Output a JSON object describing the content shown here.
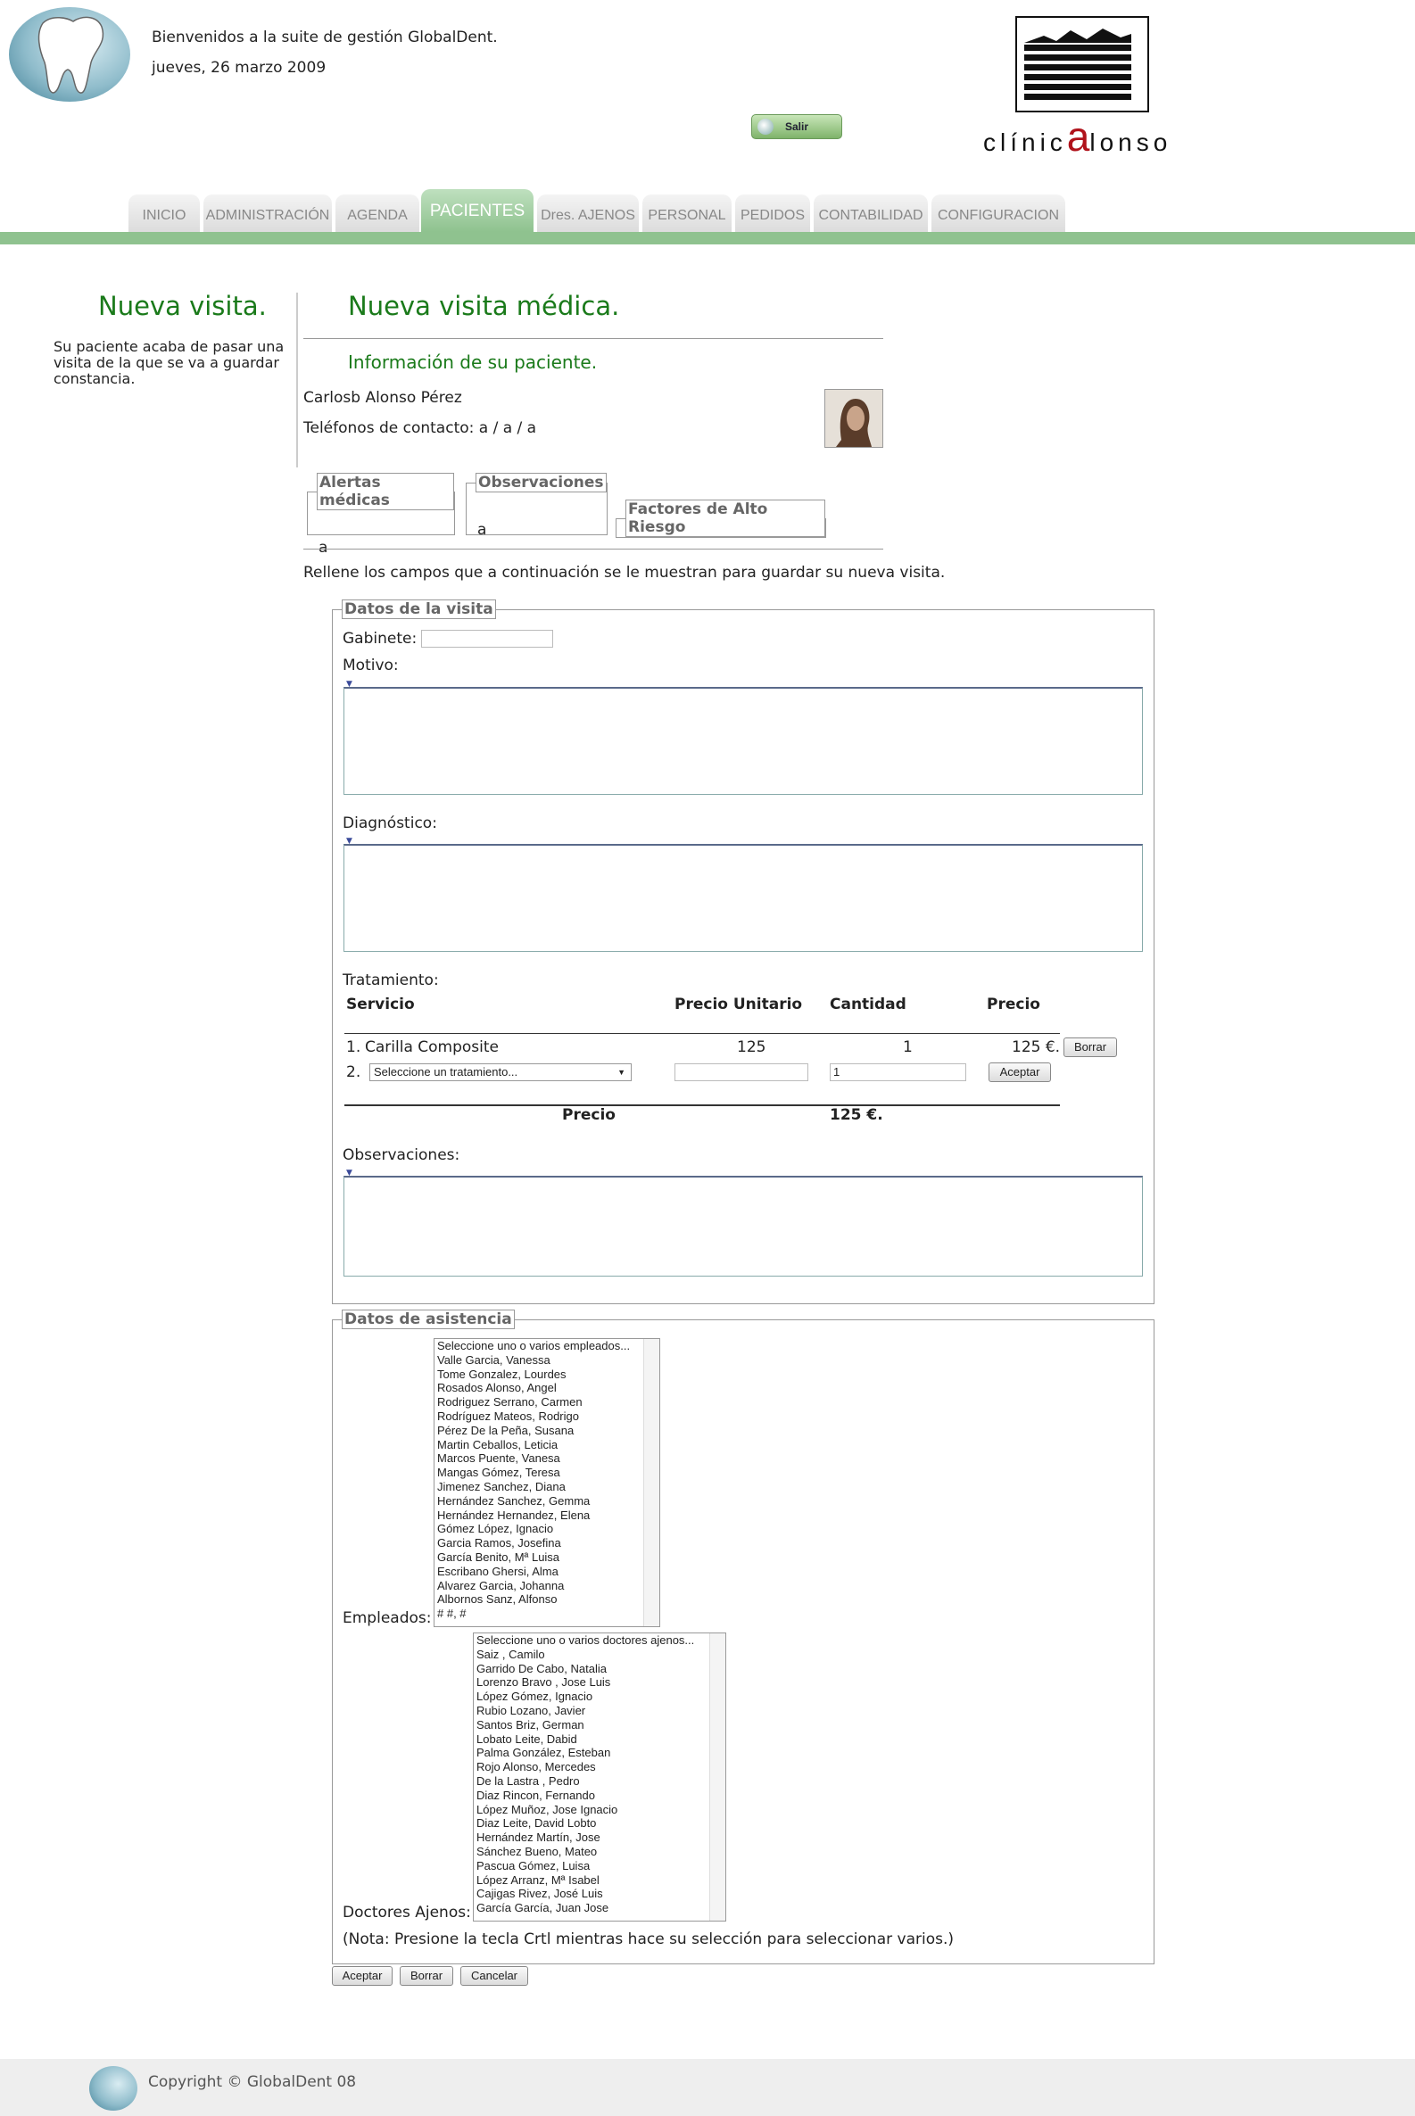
{
  "header": {
    "welcome": "Bienvenidos a la suite de gestión GlobalDent.",
    "date": "jueves, 26 marzo 2009",
    "exit_label": "Salir",
    "brand_prefix": "clínic",
    "brand_letter": "a",
    "brand_suffix": "lonso"
  },
  "nav": {
    "tabs": [
      "INICIO",
      "ADMINISTRACIÓN",
      "AGENDA",
      "PACIENTES",
      "Dres. AJENOS",
      "PERSONAL",
      "PEDIDOS",
      "CONTABILIDAD",
      "CONFIGURACION"
    ],
    "active": "PACIENTES"
  },
  "sidebar": {
    "title": "Nueva visita.",
    "text": "Su paciente acaba de pasar una visita de la que se va a guardar constancia."
  },
  "main": {
    "title": "Nueva visita médica.",
    "info_title": "Información de su paciente.",
    "patient_name": "Carlosb Alonso Pérez",
    "phones": "Teléfonos de contacto: a / a / a",
    "alerts_legend": "Alertas médicas",
    "alerts_value": "a",
    "obs_legend": "Observaciones",
    "obs_value": "a",
    "risk_legend": "Factores de Alto Riesgo",
    "fill_text": "Rellene los campos que a continuación se le muestran para guardar su nueva visita."
  },
  "visit": {
    "legend": "Datos de la visita",
    "gabinete_label": "Gabinete:",
    "motivo_label": "Motivo:",
    "diagnostico_label": "Diagnóstico:",
    "tratamiento_label": "Tratamiento:",
    "columns": [
      "Servicio",
      "Precio Unitario",
      "Cantidad",
      "Precio"
    ],
    "row1": {
      "index": "1.",
      "service": "Carilla Composite",
      "unit_price": "125",
      "quantity": "1",
      "price": "125 €.",
      "delete_label": "Borrar"
    },
    "row2": {
      "index": "2.",
      "select_placeholder": "Seleccione un tratamiento...",
      "quantity": "1",
      "accept_label": "Aceptar"
    },
    "total_label": "Precio",
    "total_value": "125 €.",
    "observaciones_label": "Observaciones:"
  },
  "assistance": {
    "legend": "Datos de asistencia",
    "employees_label": "Empleados:",
    "employees": [
      "Seleccione uno o varios empleados...",
      "Valle Garcia, Vanessa",
      "Tome Gonzalez, Lourdes",
      "Rosados Alonso, Angel",
      "Rodriguez Serrano, Carmen",
      "Rodríguez Mateos, Rodrigo",
      "Pérez De la Peña, Susana",
      "Martin Ceballos, Leticia",
      "Marcos Puente, Vanesa",
      "Mangas Gómez, Teresa",
      "Jimenez Sanchez, Diana",
      "Hernández Sanchez, Gemma",
      "Hernández Hernandez, Elena",
      "Gómez López, Ignacio",
      "Garcia Ramos, Josefina",
      "García Benito, Mª Luisa",
      "Escribano Ghersi, Alma",
      "Alvarez Garcia, Johanna",
      "Albornos Sanz, Alfonso",
      "# #, #"
    ],
    "doctors_label": "Doctores Ajenos:",
    "doctors": [
      "Seleccione uno o varios doctores ajenos...",
      "Saiz , Camilo",
      "Garrido De Cabo, Natalia",
      "Lorenzo Bravo , Jose Luis",
      "López Gómez, Ignacio",
      "Rubio Lozano, Javier",
      "Santos Briz, German",
      "Lobato Leite, Dabid",
      "Palma González, Esteban",
      "Rojo Alonso, Mercedes",
      "De la Lastra , Pedro",
      "Diaz Rincon, Fernando",
      "López Muñoz, Jose Ignacio",
      "Diaz Leite, David Lobto",
      "Hernández Martín, Jose",
      "Sánchez Bueno, Mateo",
      "Pascua Gómez, Luisa",
      "López Arranz, Mª Isabel",
      "Cajigas Rivez, José Luis",
      "García García, Juan Jose"
    ],
    "note": "(Nota: Presione la tecla Crtl mientras hace su selección para seleccionar varios.)"
  },
  "actions": {
    "accept": "Aceptar",
    "delete": "Borrar",
    "cancel": "Cancelar"
  },
  "footer": {
    "copyright": "Copyright © GlobalDent 08"
  }
}
